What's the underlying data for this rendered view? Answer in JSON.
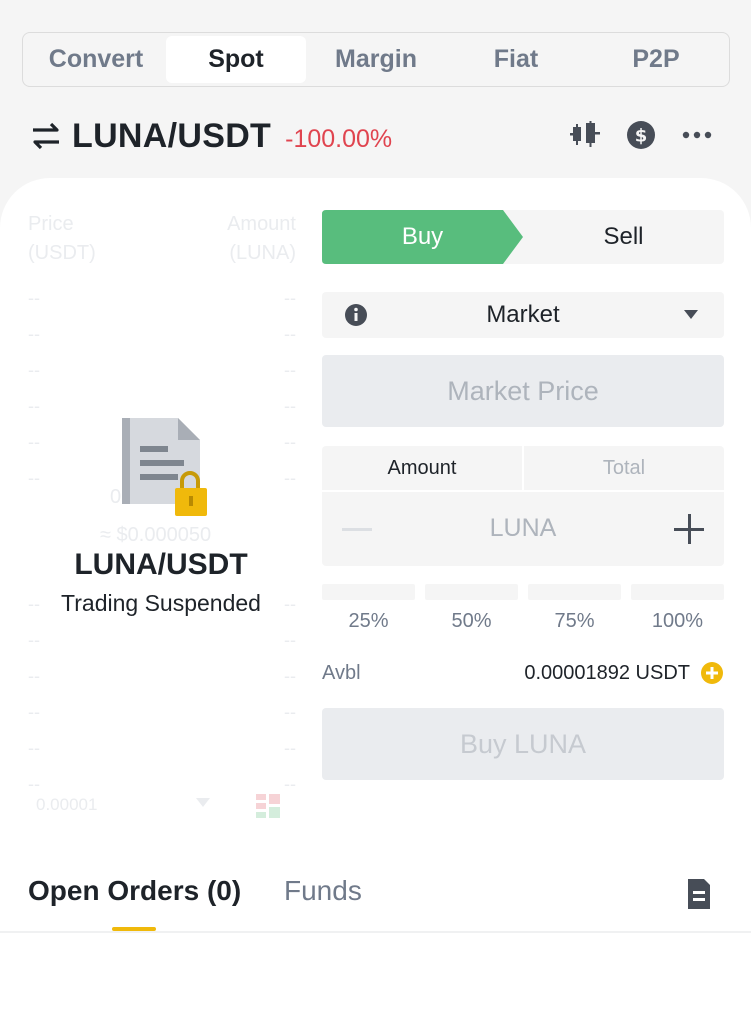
{
  "mode_tabs": [
    {
      "label": "Convert",
      "active": false
    },
    {
      "label": "Spot",
      "active": true
    },
    {
      "label": "Margin",
      "active": false
    },
    {
      "label": "Fiat",
      "active": false
    },
    {
      "label": "P2P",
      "active": false
    }
  ],
  "pair": {
    "name": "LUNA/USDT",
    "change": "-100.00%",
    "change_color": "#e0444f"
  },
  "header_icons": [
    "candlestick-chart-icon",
    "dollar-coin-icon",
    "more-options-icon"
  ],
  "orderbook": {
    "price_header": "Price",
    "price_unit": "(USDT)",
    "amount_header": "Amount",
    "amount_unit": "(LUNA)",
    "placeholder": "--",
    "mid_price": "0",
    "mid_fiat": "≈ $0.000050",
    "step": "0.00001"
  },
  "suspended": {
    "pair": "LUNA/USDT",
    "message": "Trading Suspended"
  },
  "trade": {
    "buy_label": "Buy",
    "sell_label": "Sell",
    "buy_color": "#58bd7d",
    "order_type": "Market",
    "market_price_placeholder": "Market Price",
    "amount_tab": "Amount",
    "total_tab": "Total",
    "amount_unit": "LUNA",
    "percentages": [
      "25%",
      "50%",
      "75%",
      "100%"
    ],
    "avbl_label": "Avbl",
    "avbl_value": "0.00001892 USDT",
    "submit_label": "Buy LUNA"
  },
  "bottom_tabs": {
    "open_orders": "Open Orders (0)",
    "funds": "Funds",
    "accent": "#f0b90b"
  }
}
